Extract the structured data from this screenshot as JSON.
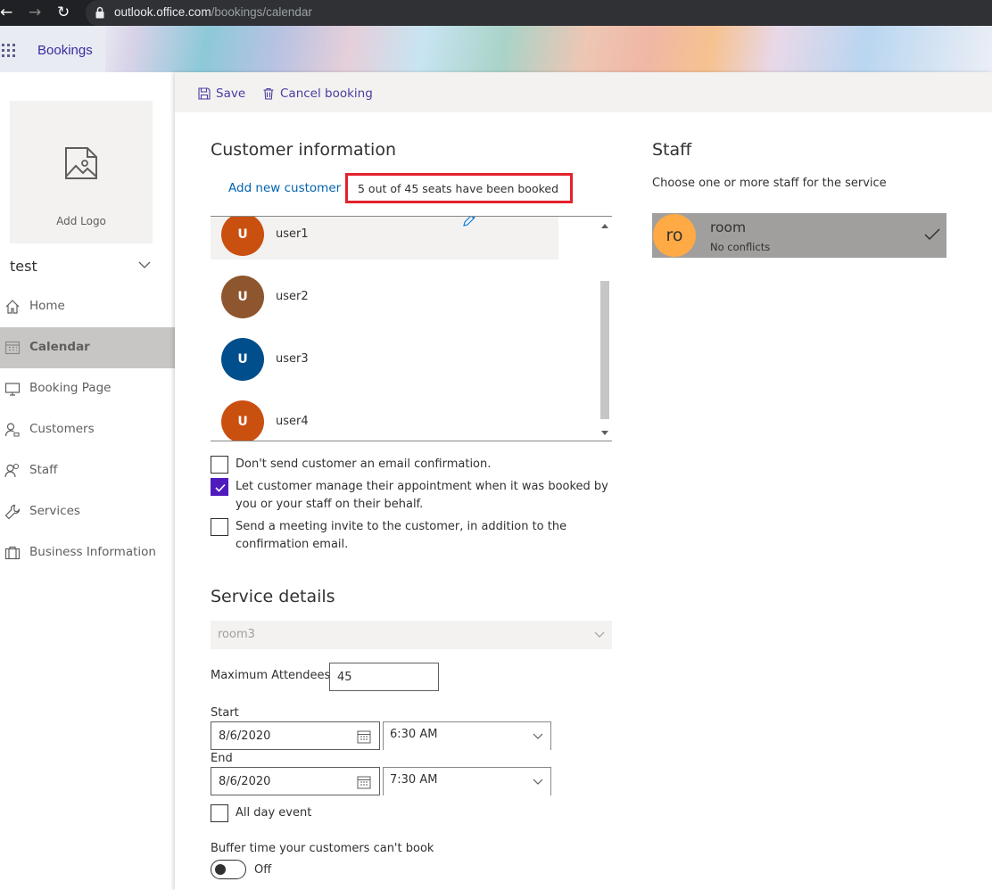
{
  "browser": {
    "url_host": "outlook.office.com",
    "url_path": "/bookings/calendar"
  },
  "app": {
    "title": "Bookings"
  },
  "sidebar": {
    "logo_label": "Add Logo",
    "business_name": "test",
    "items": [
      {
        "label": "Home",
        "icon": "home-icon",
        "active": false
      },
      {
        "label": "Calendar",
        "icon": "calendar-icon",
        "active": true
      },
      {
        "label": "Booking Page",
        "icon": "monitor-icon",
        "active": false
      },
      {
        "label": "Customers",
        "icon": "customers-icon",
        "active": false
      },
      {
        "label": "Staff",
        "icon": "staff-icon",
        "active": false
      },
      {
        "label": "Services",
        "icon": "wrench-icon",
        "active": false
      },
      {
        "label": "Business Information",
        "icon": "briefcase-icon",
        "active": false
      }
    ]
  },
  "toolbar": {
    "save_label": "Save",
    "cancel_label": "Cancel booking"
  },
  "customer_info": {
    "title": "Customer information",
    "add_new_label": "Add new customer",
    "seats_text": "5 out of 45 seats have been booked",
    "customers": [
      {
        "initial": "U",
        "name": "user1",
        "color": "#ca5010",
        "selected": true
      },
      {
        "initial": "U",
        "name": "user2",
        "color": "#8e562e",
        "selected": false
      },
      {
        "initial": "U",
        "name": "user3",
        "color": "#004e8c",
        "selected": false
      },
      {
        "initial": "U",
        "name": "user4",
        "color": "#ca5010",
        "selected": false
      }
    ],
    "options": [
      {
        "label": "Don't send customer an email confirmation.",
        "checked": false
      },
      {
        "label": "Let customer manage their appointment when it was booked by you or your staff on their behalf.",
        "checked": true
      },
      {
        "label": "Send a meeting invite to the customer, in addition to the confirmation email.",
        "checked": false
      }
    ]
  },
  "service_details": {
    "title": "Service details",
    "service_value": "room3",
    "max_attendees_label": "Maximum Attendees",
    "max_attendees_value": "45",
    "start_label": "Start",
    "start_date": "8/6/2020",
    "start_time": "6:30 AM",
    "end_label": "End",
    "end_date": "8/6/2020",
    "end_time": "7:30 AM",
    "all_day_label": "All day event",
    "buffer_label": "Buffer time your customers can't book",
    "buffer_state": "Off"
  },
  "staff": {
    "title": "Staff",
    "description": "Choose one or more staff for the service",
    "members": [
      {
        "initials": "ro",
        "name": "room",
        "status": "No conflicts",
        "selected": true
      }
    ]
  },
  "colors": {
    "accent": "#4f1bbd",
    "link": "#0063b1",
    "highlight_border": "#e3222c",
    "staff_avatar": "#ffaa44"
  }
}
